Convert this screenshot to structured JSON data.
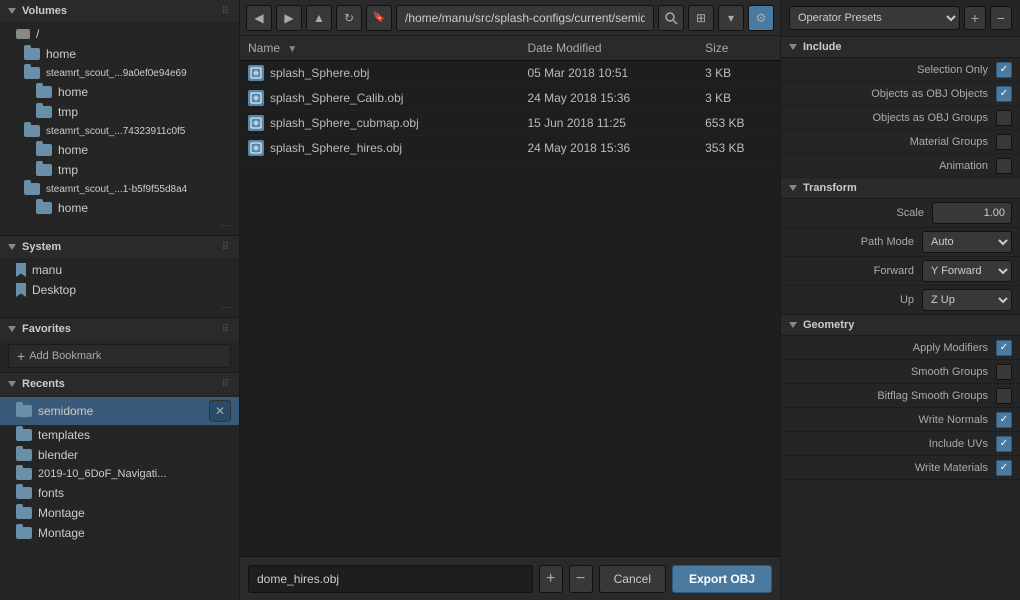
{
  "sidebar": {
    "volumes_label": "Volumes",
    "system_label": "System",
    "favorites_label": "Favorites",
    "recents_label": "Recents",
    "volumes": [
      {
        "label": "/",
        "type": "drive"
      },
      {
        "label": "home",
        "indent": 1,
        "type": "folder"
      },
      {
        "label": "steamrt_scout_...9a0ef0e94e69",
        "indent": 1,
        "type": "folder"
      },
      {
        "label": "home",
        "indent": 2,
        "type": "folder"
      },
      {
        "label": "tmp",
        "indent": 2,
        "type": "folder"
      },
      {
        "label": "steamrt_scout_...74323911c0f5",
        "indent": 1,
        "type": "folder"
      },
      {
        "label": "home",
        "indent": 2,
        "type": "folder"
      },
      {
        "label": "tmp",
        "indent": 2,
        "type": "folder"
      },
      {
        "label": "steamrt_scout_...1-b5f9f55d8a4",
        "indent": 1,
        "type": "folder"
      },
      {
        "label": "home",
        "indent": 2,
        "type": "folder"
      }
    ],
    "system_items": [
      {
        "label": "manu",
        "type": "bookmark"
      },
      {
        "label": "Desktop",
        "type": "bookmark"
      }
    ],
    "add_bookmark_label": "Add Bookmark",
    "recents_items": [
      {
        "label": "semidome",
        "selected": true
      },
      {
        "label": "templates"
      },
      {
        "label": "blender"
      },
      {
        "label": "2019-10_6DoF_Navigati..."
      },
      {
        "label": "fonts"
      },
      {
        "label": "Montage"
      },
      {
        "label": "Montage"
      }
    ]
  },
  "toolbar": {
    "path": "/home/manu/src/splash-configs/current/semidome/",
    "search_placeholder": "Search"
  },
  "file_table": {
    "headers": [
      {
        "label": "Name",
        "sort": true
      },
      {
        "label": "Date Modified",
        "sort": false
      },
      {
        "label": "Size",
        "sort": false
      }
    ],
    "rows": [
      {
        "name": "splash_Sphere.obj",
        "date": "05 Mar 2018 10:51",
        "size": "3 KB"
      },
      {
        "name": "splash_Sphere_Calib.obj",
        "date": "24 May 2018 15:36",
        "size": "3 KB"
      },
      {
        "name": "splash_Sphere_cubmap.obj",
        "date": "15 Jun 2018 11:25",
        "size": "653 KB"
      },
      {
        "name": "splash_Sphere_hires.obj",
        "date": "24 May 2018 15:36",
        "size": "353 KB"
      }
    ]
  },
  "bottom_bar": {
    "filename": "dome_hires.obj",
    "cancel_label": "Cancel",
    "export_label": "Export OBJ"
  },
  "right_panel": {
    "preset_label": "Operator Presets",
    "add_label": "+",
    "remove_label": "−",
    "include_section": "Include",
    "transform_section": "Transform",
    "geometry_section": "Geometry",
    "rows": {
      "include": [
        {
          "label": "Selection Only",
          "checked": true
        },
        {
          "label": "Objects as OBJ Objects",
          "checked": true
        },
        {
          "label": "Objects as OBJ Groups",
          "checked": false
        },
        {
          "label": "Material Groups",
          "checked": false
        },
        {
          "label": "Animation",
          "checked": false
        }
      ],
      "transform": [
        {
          "label": "Scale",
          "type": "input",
          "value": "1.00"
        },
        {
          "label": "Path Mode",
          "type": "select",
          "value": "Auto"
        },
        {
          "label": "Forward",
          "type": "select",
          "value": "Y Forward"
        },
        {
          "label": "Up",
          "type": "select",
          "value": "Z Up"
        }
      ],
      "geometry": [
        {
          "label": "Apply Modifiers",
          "checked": true
        },
        {
          "label": "Smooth Groups",
          "checked": false
        },
        {
          "label": "Bitflag Smooth Groups",
          "checked": false
        },
        {
          "label": "Write Normals",
          "checked": true
        },
        {
          "label": "Include UVs",
          "checked": true
        },
        {
          "label": "Write Materials",
          "checked": true
        }
      ]
    }
  }
}
